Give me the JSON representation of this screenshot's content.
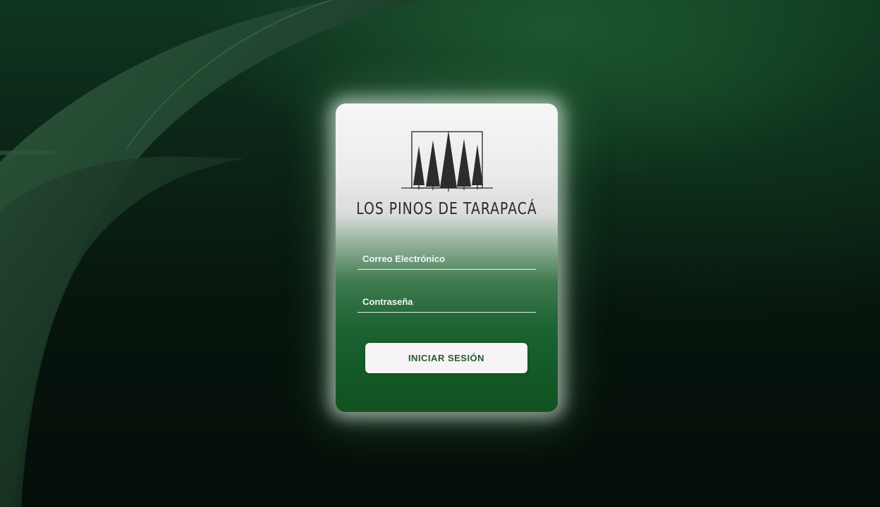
{
  "brand": {
    "name": "LOS PINOS DE TARAPACÁ",
    "logo_icon": "pine-trees-icon"
  },
  "form": {
    "email_label": "Correo Electrónico",
    "password_label": "Contraseña",
    "email_value": "",
    "password_value": "",
    "submit_label": "INICIAR SESIÓN"
  },
  "colors": {
    "card_top": "#f6f6f6",
    "card_bottom": "#11521f",
    "button_bg": "#f6f4f6",
    "button_text": "#255c2e",
    "background": "#07150d"
  }
}
